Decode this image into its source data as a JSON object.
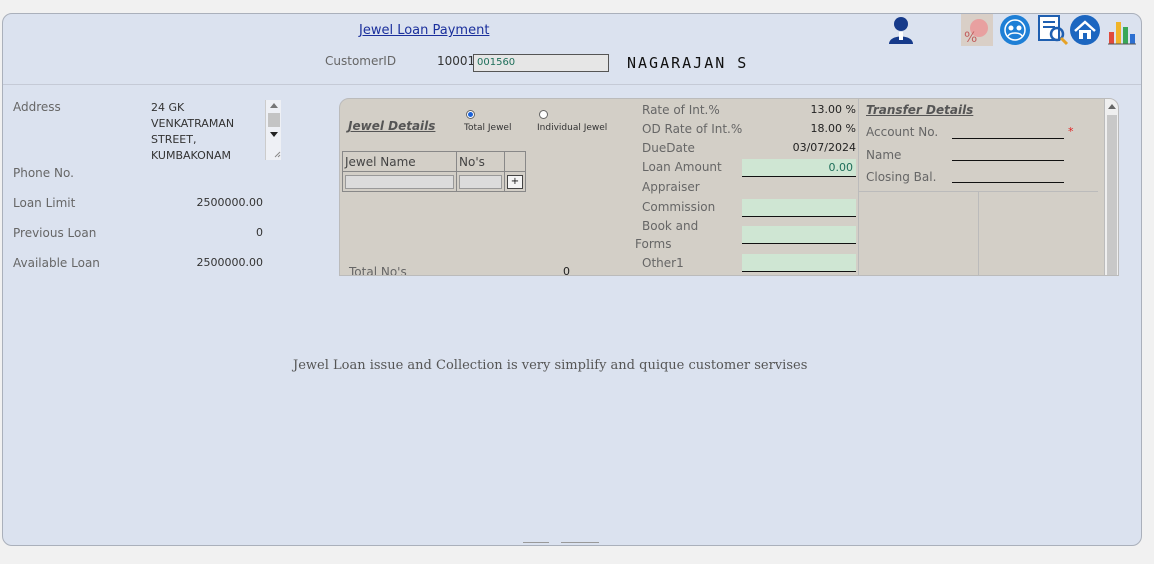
{
  "header": {
    "title": "Jewel Loan Payment",
    "customer_id_label": "CustomerID",
    "customer_id_prefix": "10001",
    "customer_id_value": "001560",
    "customer_name": "NAGARAJAN S"
  },
  "icons": [
    "user-icon",
    "percent-icon",
    "customer-support-icon",
    "search-report-icon",
    "home-icon",
    "bar-chart-icon"
  ],
  "customer": {
    "address_label": "Address",
    "address_lines": [
      "24 GK",
      "VENKATRAMAN",
      "STREET,",
      "KUMBAKONAM"
    ],
    "phone_label": "Phone No.",
    "loan_limit_label": "Loan Limit",
    "loan_limit": "2500000.00",
    "previous_loan_label": "Previous Loan",
    "previous_loan": "0",
    "available_loan_label": "Available Loan",
    "available_loan": "2500000.00"
  },
  "jewel": {
    "section_title": "Jewel Details",
    "radio_total": "Total Jewel",
    "radio_individual": "Individual Jewel",
    "col_name": "Jewel Name",
    "col_nos": "No's",
    "add_button": "+",
    "total_label": "Total No's",
    "total_value": "0"
  },
  "loan": {
    "rate_label": "Rate of Int.%",
    "rate_value": "13.00 %",
    "od_rate_label": "OD Rate of Int.%",
    "od_rate_value": "18.00 %",
    "due_label": "DueDate",
    "due_value": "03/07/2024",
    "loan_amount_label": "Loan Amount",
    "loan_amount_value": "0.00",
    "appraiser_label": "Appraiser",
    "commission_label": "Commission",
    "book_label_1": "Book and",
    "book_label_2": "Forms",
    "other_label": "Other1"
  },
  "transfer": {
    "section_title": "Transfer Details",
    "account_label": "Account No.",
    "required_mark": "*",
    "name_label": "Name",
    "closing_label": "Closing Bal."
  },
  "footer": {
    "tagline": "Jewel Loan  issue and Collection is very simplify and quique customer servises"
  },
  "colors": {
    "background": "#dbe2ef",
    "panel": "#d3cfc7",
    "field_green": "#cfe6d3",
    "title_blue": "#1a2f9c"
  }
}
